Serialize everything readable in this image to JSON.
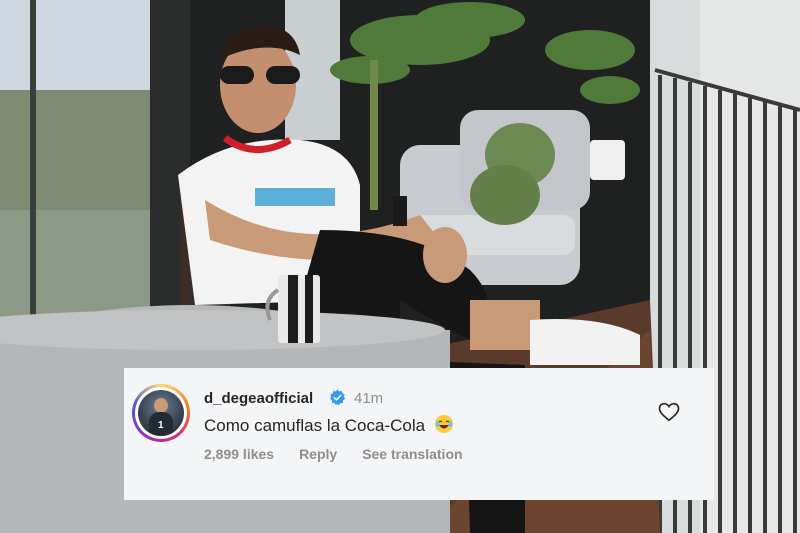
{
  "comment": {
    "username": "d_degeaofficial",
    "time": "41m",
    "text": "Como camuflas la Coca-Cola",
    "likes": "2,899 likes",
    "reply": "Reply",
    "translation": "See translation",
    "avatar_number": "1"
  },
  "icons": {
    "verified": "verified-badge-icon",
    "emoji": "laughing-emoji-icon",
    "like": "heart-icon"
  },
  "colors": {
    "verified_blue": "#3897f0",
    "card_bg": "#f4f5f7"
  }
}
